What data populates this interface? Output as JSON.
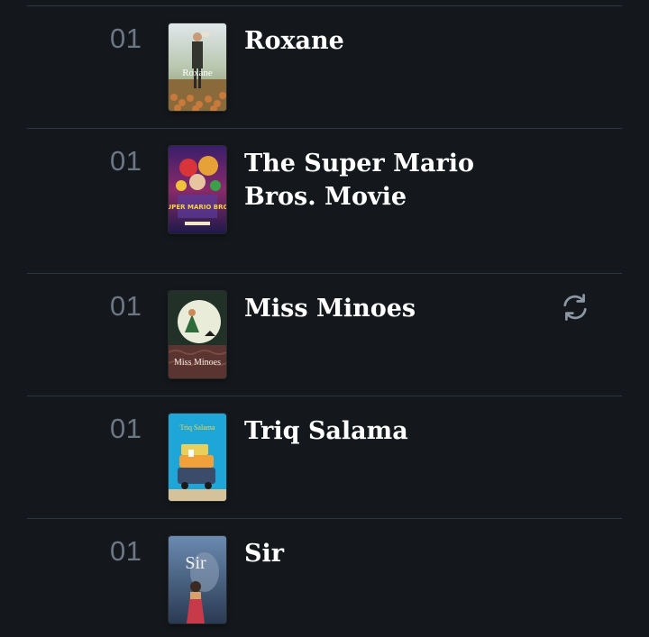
{
  "colors": {
    "background": "#14181c",
    "divider": "#2c3440",
    "rank_text": "#6c7785",
    "title_text": "#ffffff",
    "icon": "#8c97a3"
  },
  "entries": [
    {
      "rank": "01",
      "title": "Roxane",
      "poster_text": "Roxane",
      "rewatch": false
    },
    {
      "rank": "01",
      "title": "The Super Mario Bros. Movie",
      "poster_text": "SUPER MARIO BROS",
      "rewatch": false
    },
    {
      "rank": "01",
      "title": "Miss Minoes",
      "poster_text": "Miss Minoes",
      "rewatch": true,
      "rewatch_icon": "rewatch-icon"
    },
    {
      "rank": "01",
      "title": "Triq Salama",
      "poster_text": "Triq Salama",
      "rewatch": false
    },
    {
      "rank": "01",
      "title": "Sir",
      "poster_text": "Sir",
      "rewatch": false
    }
  ]
}
